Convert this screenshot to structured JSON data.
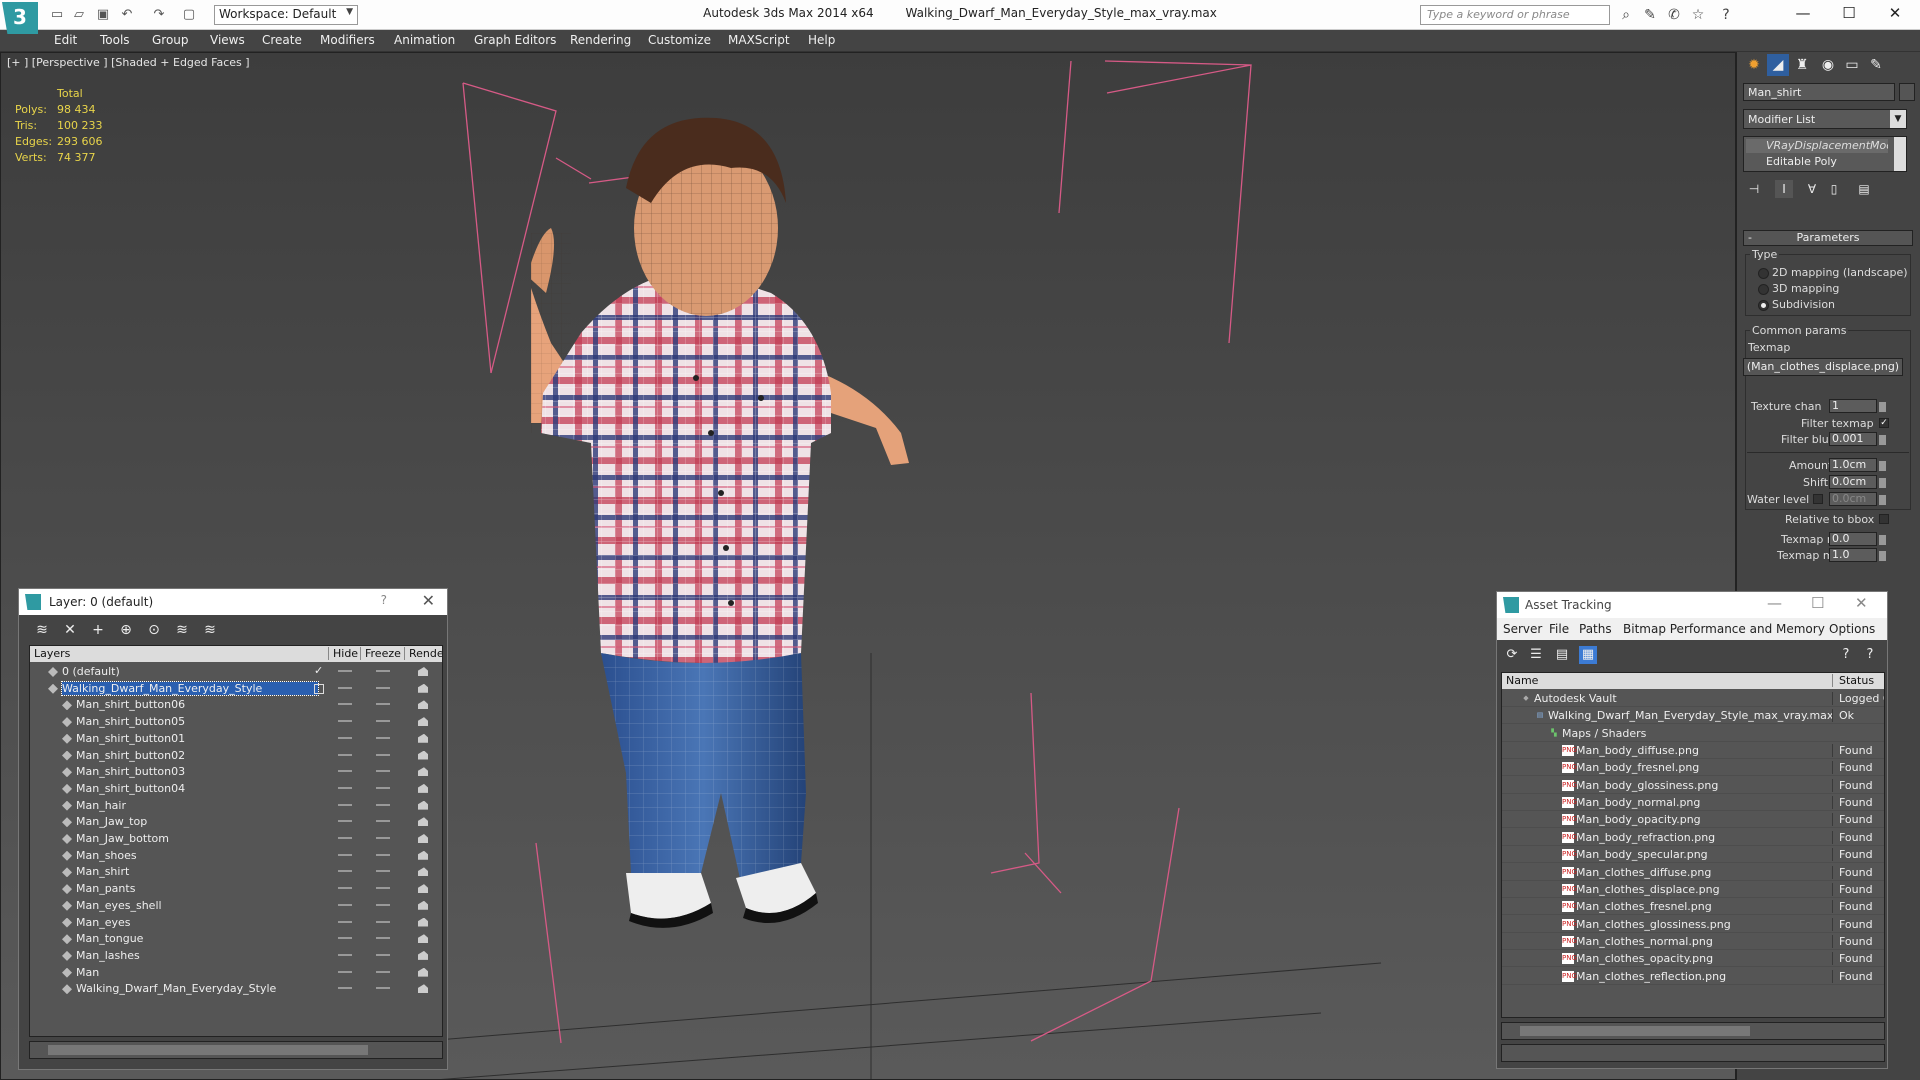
{
  "titlebar": {
    "workspace": "Workspace: Default",
    "app_name": "Autodesk 3ds Max  2014 x64",
    "file_name": "Walking_Dwarf_Man_Everyday_Style_max_vray.max",
    "search_placeholder": "Type a keyword or phrase"
  },
  "menu": [
    "Edit",
    "Tools",
    "Group",
    "Views",
    "Create",
    "Modifiers",
    "Animation",
    "Graph Editors",
    "Rendering",
    "Customize",
    "MAXScript",
    "Help"
  ],
  "viewport": {
    "label": "[+ ] [Perspective ] [Shaded + Edged Faces ]",
    "stats": {
      "header": "Total",
      "rows": [
        {
          "label": "Polys:",
          "value": "98 434"
        },
        {
          "label": "Tris:",
          "value": "100 233"
        },
        {
          "label": "Edges:",
          "value": "293 606"
        },
        {
          "label": "Verts:",
          "value": "74 377"
        }
      ]
    }
  },
  "layer_panel": {
    "title": "Layer: 0 (default)",
    "help": "?",
    "columns": {
      "layers": "Layers",
      "hide": "Hide",
      "freeze": "Freeze",
      "render": "Render"
    },
    "rows": [
      {
        "name": "0 (default)",
        "level": 0
      },
      {
        "name": "Walking_Dwarf_Man_Everyday_Style",
        "level": 0,
        "selected": true
      },
      {
        "name": "Man_shirt_button06",
        "level": 1
      },
      {
        "name": "Man_shirt_button05",
        "level": 1
      },
      {
        "name": "Man_shirt_button01",
        "level": 1
      },
      {
        "name": "Man_shirt_button02",
        "level": 1
      },
      {
        "name": "Man_shirt_button03",
        "level": 1
      },
      {
        "name": "Man_shirt_button04",
        "level": 1
      },
      {
        "name": "Man_hair",
        "level": 1
      },
      {
        "name": "Man_Jaw_top",
        "level": 1
      },
      {
        "name": "Man_Jaw_bottom",
        "level": 1
      },
      {
        "name": "Man_shoes",
        "level": 1
      },
      {
        "name": "Man_shirt",
        "level": 1
      },
      {
        "name": "Man_pants",
        "level": 1
      },
      {
        "name": "Man_eyes_shell",
        "level": 1
      },
      {
        "name": "Man_eyes",
        "level": 1
      },
      {
        "name": "Man_tongue",
        "level": 1
      },
      {
        "name": "Man_lashes",
        "level": 1
      },
      {
        "name": "Man",
        "level": 1
      },
      {
        "name": "Walking_Dwarf_Man_Everyday_Style",
        "level": 1
      }
    ]
  },
  "command_panel": {
    "object_name": "Man_shirt",
    "modifier_list": "Modifier List",
    "stack": [
      "VRayDisplacementMod",
      "Editable Poly"
    ],
    "params_title": "Parameters",
    "type_label": "Type",
    "type_options": [
      "2D mapping (landscape)",
      "3D mapping",
      "Subdivision"
    ],
    "type_selected": "Subdivision",
    "common_label": "Common params",
    "texmap_label": "Texmap",
    "texmap_value": "(Man_clothes_displace.png)",
    "texture_chan_label": "Texture chan",
    "texture_chan_value": "1",
    "filter_texmap_label": "Filter texmap",
    "filter_blur_label": "Filter blur",
    "filter_blur_value": "0.001",
    "amount_label": "Amount",
    "amount_value": "1.0cm",
    "shift_label": "Shift",
    "shift_value": "0.0cm",
    "water_label": "Water level",
    "water_value": "0.0cm",
    "relative_label": "Relative to bbox",
    "texmap_min_label": "Texmap min",
    "texmap_min_value": "0.0",
    "texmap_max_label": "Texmap max",
    "texmap_max_value": "1.0"
  },
  "asset_panel": {
    "title": "Asset Tracking",
    "menu": [
      "Server",
      "File",
      "Paths",
      "Bitmap Performance and Memory",
      "Options"
    ],
    "columns": {
      "name": "Name",
      "status": "Status"
    },
    "rows": [
      {
        "name": "Autodesk Vault",
        "status": "Logged O",
        "level": 0,
        "icon": "vault"
      },
      {
        "name": "Walking_Dwarf_Man_Everyday_Style_max_vray.max",
        "status": "Ok",
        "level": 1,
        "icon": "file"
      },
      {
        "name": "Maps / Shaders",
        "status": "",
        "level": 2,
        "icon": "maps"
      },
      {
        "name": "Man_body_diffuse.png",
        "status": "Found",
        "level": 3,
        "icon": "png"
      },
      {
        "name": "Man_body_fresnel.png",
        "status": "Found",
        "level": 3,
        "icon": "png"
      },
      {
        "name": "Man_body_glossiness.png",
        "status": "Found",
        "level": 3,
        "icon": "png"
      },
      {
        "name": "Man_body_normal.png",
        "status": "Found",
        "level": 3,
        "icon": "png"
      },
      {
        "name": "Man_body_opacity.png",
        "status": "Found",
        "level": 3,
        "icon": "png"
      },
      {
        "name": "Man_body_refraction.png",
        "status": "Found",
        "level": 3,
        "icon": "png"
      },
      {
        "name": "Man_body_specular.png",
        "status": "Found",
        "level": 3,
        "icon": "png"
      },
      {
        "name": "Man_clothes_diffuse.png",
        "status": "Found",
        "level": 3,
        "icon": "png"
      },
      {
        "name": "Man_clothes_displace.png",
        "status": "Found",
        "level": 3,
        "icon": "png"
      },
      {
        "name": "Man_clothes_fresnel.png",
        "status": "Found",
        "level": 3,
        "icon": "png"
      },
      {
        "name": "Man_clothes_glossiness.png",
        "status": "Found",
        "level": 3,
        "icon": "png"
      },
      {
        "name": "Man_clothes_normal.png",
        "status": "Found",
        "level": 3,
        "icon": "png"
      },
      {
        "name": "Man_clothes_opacity.png",
        "status": "Found",
        "level": 3,
        "icon": "png"
      },
      {
        "name": "Man_clothes_reflection.png",
        "status": "Found",
        "level": 3,
        "icon": "png"
      }
    ]
  }
}
